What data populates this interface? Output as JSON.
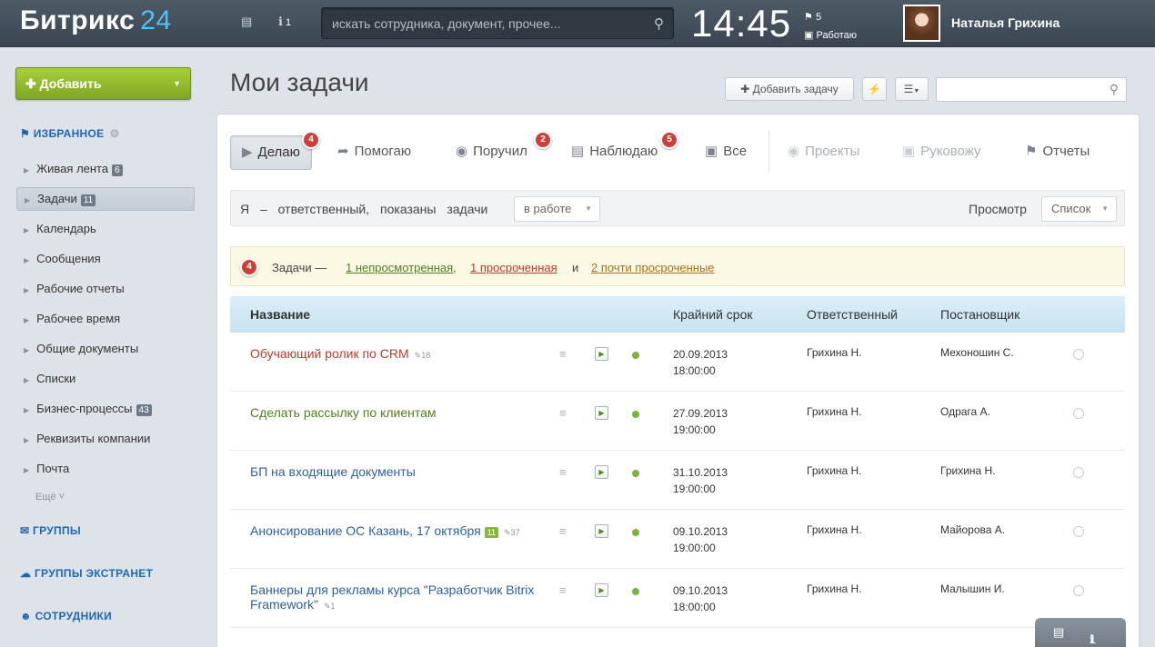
{
  "topbar": {
    "logo_text": "Битрикс",
    "logo_num": "24",
    "messages_icon": "chat-icon",
    "notify_count": "1",
    "search_placeholder": "искать сотрудника, документ, прочее...",
    "time": "14:45",
    "flag_count": "5",
    "work_status": "Работаю",
    "user_name": "Наталья Грихина"
  },
  "sidebar": {
    "add_label": "Добавить",
    "favorites": "ИЗБРАННОЕ",
    "items": [
      {
        "label": "Живая лента",
        "count": "6"
      },
      {
        "label": "Задачи",
        "count": "11"
      },
      {
        "label": "Календарь",
        "count": ""
      },
      {
        "label": "Сообщения",
        "count": ""
      },
      {
        "label": "Рабочие отчеты",
        "count": ""
      },
      {
        "label": "Рабочее время",
        "count": ""
      },
      {
        "label": "Общие документы",
        "count": ""
      },
      {
        "label": "Списки",
        "count": ""
      },
      {
        "label": "Бизнес-процессы",
        "count": "43"
      },
      {
        "label": "Реквизиты компании",
        "count": ""
      },
      {
        "label": "Почта",
        "count": ""
      }
    ],
    "more": "Ещё",
    "groups": "ГРУППЫ",
    "extranet": "ГРУППЫ ЭКСТРАНЕТ",
    "employees": "СОТРУДНИКИ"
  },
  "page": {
    "title": "Мои задачи",
    "add_task": "Добавить задачу"
  },
  "tabs": [
    {
      "label": "Делаю",
      "badge": "4"
    },
    {
      "label": "Помогаю",
      "badge": ""
    },
    {
      "label": "Поручил",
      "badge": "2"
    },
    {
      "label": "Наблюдаю",
      "badge": "5"
    },
    {
      "label": "Все",
      "badge": ""
    },
    {
      "label": "Проекты",
      "badge": ""
    },
    {
      "label": "Руковожу",
      "badge": ""
    },
    {
      "label": "Отчеты",
      "badge": ""
    }
  ],
  "filter": {
    "text": "Я – ответственный, показаны задачи",
    "status_value": "в работе",
    "view_label": "Просмотр",
    "view_value": "Список"
  },
  "notice": {
    "count": "4",
    "prefix": "Задачи —",
    "unviewed": "1 непросмотренная",
    "overdue": "1 просроченная",
    "and": "и",
    "almost": "2 почти просроченные"
  },
  "table": {
    "headers": {
      "name": "Название",
      "deadline": "Крайний срок",
      "responsible": "Ответственный",
      "creator": "Постановщик"
    },
    "rows": [
      {
        "name": "Обучающий ролик по CRM",
        "tag": "",
        "comments": "18",
        "date": "20.09.2013",
        "time": "18:00:00",
        "responsible": "Грихина Н.",
        "creator": "Мехоношин С.",
        "color": "#c0392b"
      },
      {
        "name": "Сделать рассылку по клиентам",
        "tag": "",
        "comments": "",
        "date": "27.09.2013",
        "time": "19:00:00",
        "responsible": "Грихина Н.",
        "creator": "Одрага А.",
        "color": "#4f7f1f"
      },
      {
        "name": "БП на входящие документы",
        "tag": "",
        "comments": "",
        "date": "31.10.2013",
        "time": "19:00:00",
        "responsible": "Грихина Н.",
        "creator": "Грихина Н.",
        "color": "#2e5f9e"
      },
      {
        "name": "Анонсирование ОС Казань, 17 октября",
        "tag": "11",
        "comments": "37",
        "date": "09.10.2013",
        "time": "19:00:00",
        "responsible": "Грихина Н.",
        "creator": "Майорова А.",
        "color": "#2e5f9e"
      },
      {
        "name": "Баннеры для рекламы курса \"Разработчик Bitrix Framework\"",
        "tag": "",
        "comments": "1",
        "date": "09.10.2013",
        "time": "18:00:00",
        "responsible": "Грихина Н.",
        "creator": "Малышин И.",
        "color": "#2e5f9e"
      }
    ]
  },
  "chat": {
    "count": "1"
  }
}
